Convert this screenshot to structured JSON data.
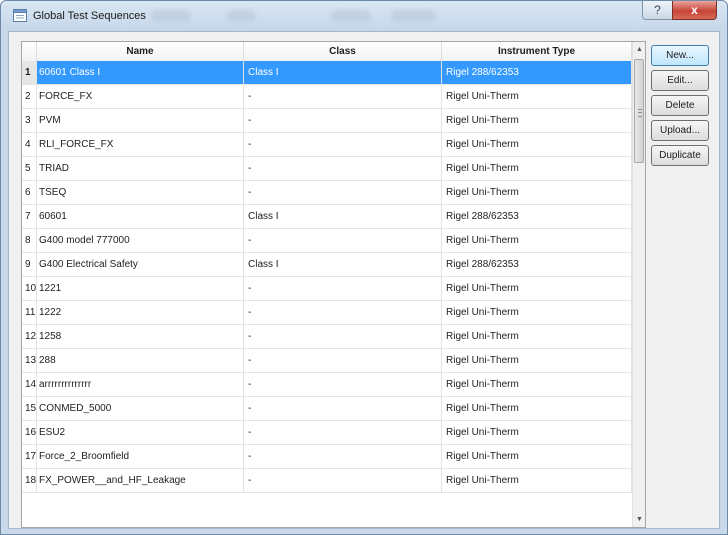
{
  "window": {
    "title": "Global Test Sequences",
    "help_glyph": "?",
    "close_glyph": "x"
  },
  "table": {
    "columns": [
      "Name",
      "Class",
      "Instrument Type"
    ],
    "rows": [
      {
        "num": "1",
        "name": "60601 Class I",
        "class": "Class I",
        "type": "Rigel 288/62353",
        "selected": true
      },
      {
        "num": "2",
        "name": "FORCE_FX",
        "class": "-",
        "type": "Rigel Uni-Therm"
      },
      {
        "num": "3",
        "name": "PVM",
        "class": "-",
        "type": "Rigel Uni-Therm"
      },
      {
        "num": "4",
        "name": "RLI_FORCE_FX",
        "class": "-",
        "type": "Rigel Uni-Therm"
      },
      {
        "num": "5",
        "name": "TRIAD",
        "class": "-",
        "type": "Rigel Uni-Therm"
      },
      {
        "num": "6",
        "name": "TSEQ",
        "class": "-",
        "type": "Rigel Uni-Therm"
      },
      {
        "num": "7",
        "name": "60601",
        "class": "Class I",
        "type": "Rigel 288/62353"
      },
      {
        "num": "8",
        "name": "G400 model 777000",
        "class": "-",
        "type": "Rigel Uni-Therm"
      },
      {
        "num": "9",
        "name": "G400 Electrical Safety",
        "class": "Class I",
        "type": "Rigel 288/62353"
      },
      {
        "num": "10",
        "name": "1221",
        "class": "-",
        "type": "Rigel Uni-Therm"
      },
      {
        "num": "11",
        "name": "1222",
        "class": "-",
        "type": "Rigel Uni-Therm"
      },
      {
        "num": "12",
        "name": "1258",
        "class": "-",
        "type": "Rigel Uni-Therm"
      },
      {
        "num": "13",
        "name": "288",
        "class": "-",
        "type": "Rigel Uni-Therm"
      },
      {
        "num": "14",
        "name": "arrrrrrrrrrrrrr",
        "class": "-",
        "type": "Rigel Uni-Therm"
      },
      {
        "num": "15",
        "name": "CONMED_5000",
        "class": "-",
        "type": "Rigel Uni-Therm"
      },
      {
        "num": "16",
        "name": "ESU2",
        "class": "-",
        "type": "Rigel Uni-Therm"
      },
      {
        "num": "17",
        "name": "Force_2_Broomfield",
        "class": "-",
        "type": "Rigel Uni-Therm"
      },
      {
        "num": "18",
        "name": "FX_POWER__and_HF_Leakage",
        "class": "-",
        "type": "Rigel Uni-Therm"
      }
    ]
  },
  "buttons": {
    "new": "New...",
    "edit": "Edit...",
    "delete": "Delete",
    "upload": "Upload...",
    "duplicate": "Duplicate"
  },
  "scrollbar": {
    "up_glyph": "▲",
    "down_glyph": "▼"
  },
  "colors": {
    "selection": "#3399ff",
    "window_frame": "#c9d9ea",
    "close_button": "#c7443a"
  }
}
